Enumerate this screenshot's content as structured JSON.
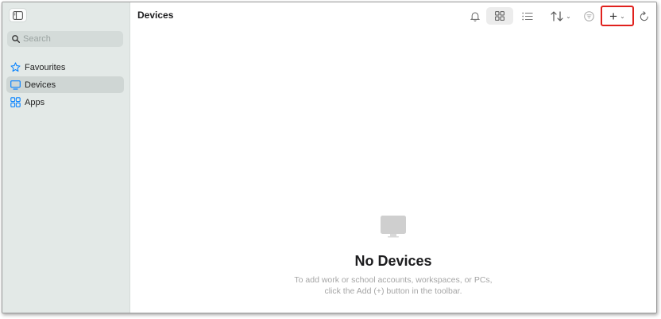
{
  "sidebar": {
    "search_placeholder": "Search",
    "items": [
      {
        "label": "Favourites",
        "icon": "star-icon",
        "active": false
      },
      {
        "label": "Devices",
        "icon": "monitor-icon",
        "active": true
      },
      {
        "label": "Apps",
        "icon": "apps-grid-icon",
        "active": false
      }
    ]
  },
  "toolbar": {
    "title": "Devices",
    "icons": [
      "bell-icon",
      "grid-view-icon",
      "list-view-icon",
      "sort-icon",
      "filter-icon",
      "add-icon",
      "refresh-icon"
    ],
    "add_label": "+"
  },
  "empty_state": {
    "title": "No Devices",
    "line1": "To add work or school accounts, workspaces, or PCs,",
    "line2": "click the Add (+) button in the toolbar."
  },
  "colors": {
    "accent": "#0a84ff",
    "sidebar_bg": "#e3e9e7",
    "highlight": "#e0211d"
  }
}
